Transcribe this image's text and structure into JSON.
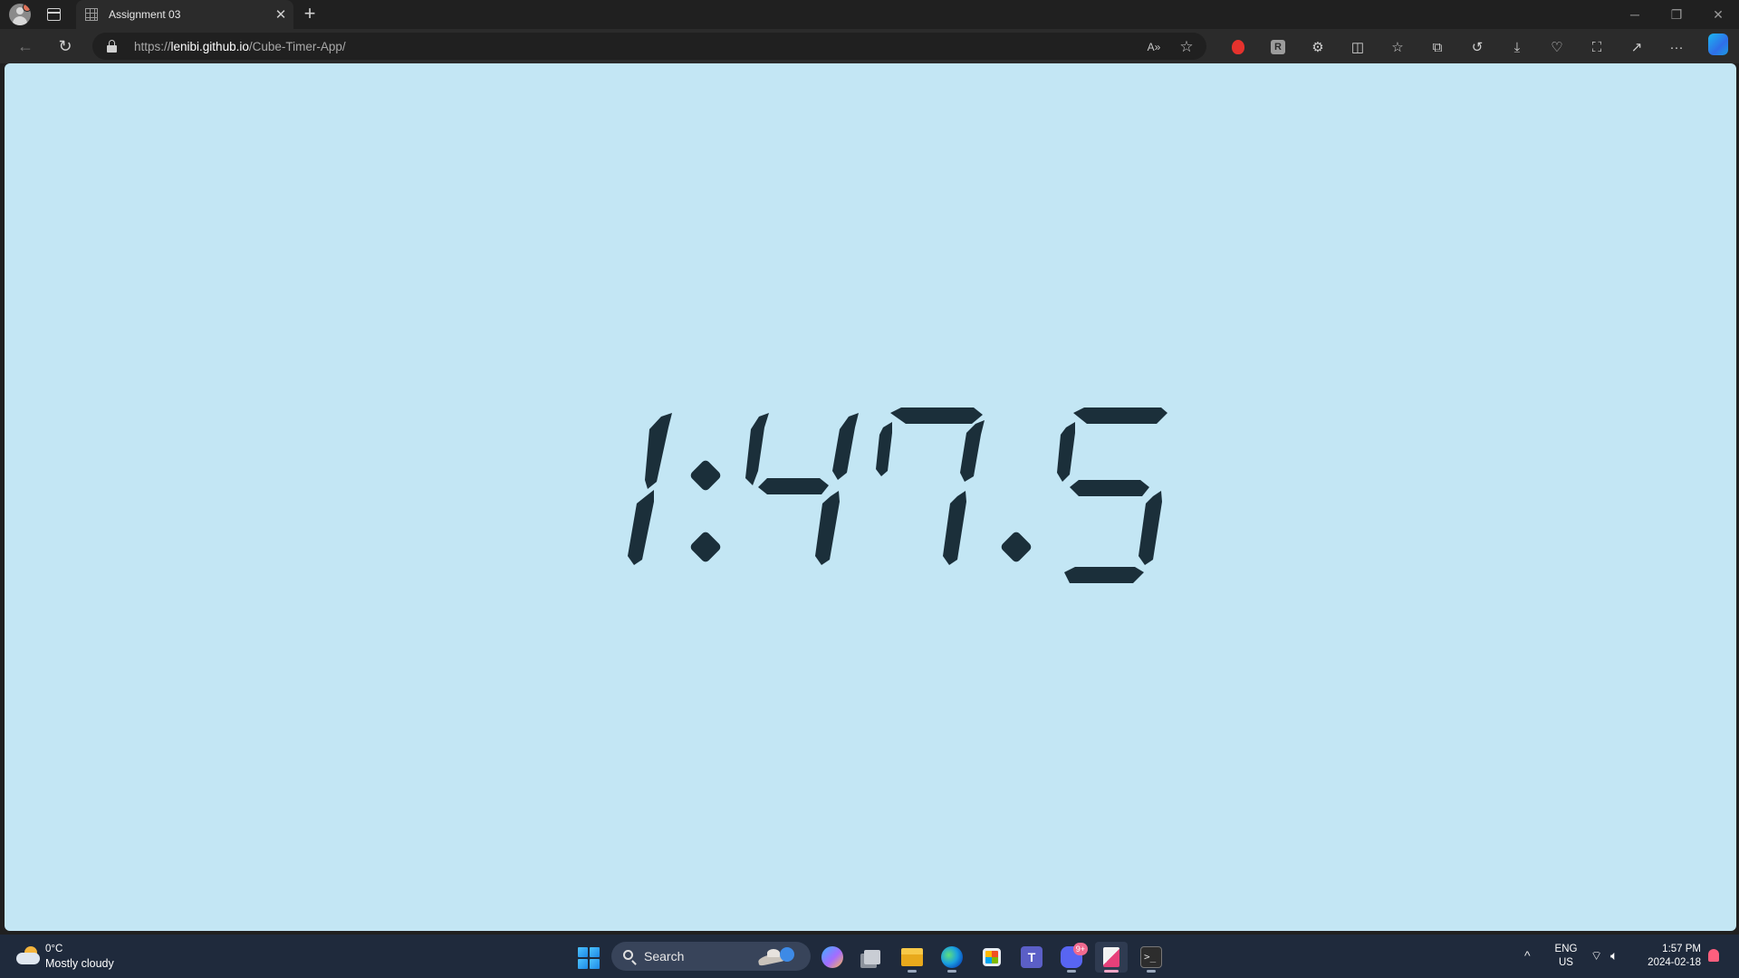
{
  "tabs": [
    {
      "title": "Assignment 03"
    }
  ],
  "address_bar": {
    "url_prefix": "https://",
    "url_host": "lenibi.github.io",
    "url_path": "/Cube-Timer-App/"
  },
  "page": {
    "background": "#c3e6f4",
    "digit_color": "#1b2f3a",
    "timer_display": "1:47.5"
  },
  "taskbar": {
    "weather": {
      "temperature": "0°C",
      "condition": "Mostly cloudy"
    },
    "search_label": "Search",
    "apps": [
      "copilot-app-icon",
      "task-view-icon",
      "file-explorer-icon",
      "edge-icon",
      "store-icon",
      "teams-icon",
      "discord-icon",
      "snipping-tool-icon",
      "terminal-icon"
    ],
    "discord_badge": "9+",
    "language": {
      "line1": "ENG",
      "line2": "US"
    },
    "time": "1:57 PM",
    "date": "2024-02-18"
  }
}
